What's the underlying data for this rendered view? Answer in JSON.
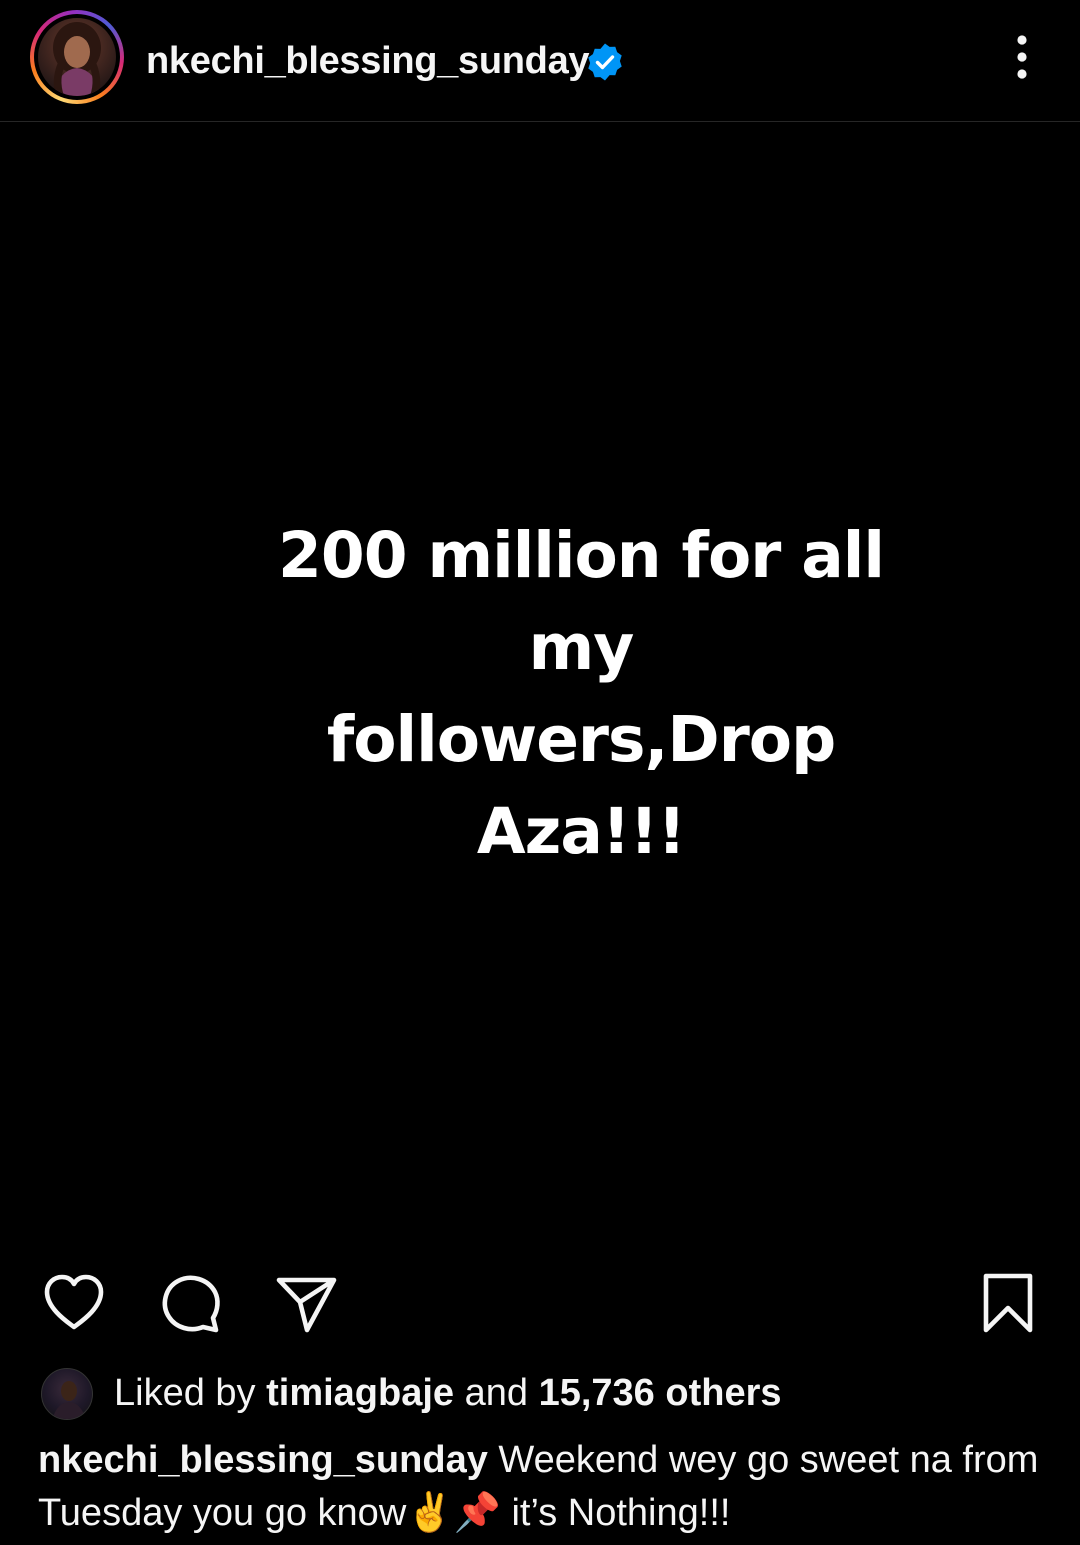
{
  "post": {
    "username": "nkechi_blessing_sunday",
    "verified": true,
    "image_text_line1": "200 million for all my",
    "image_text_line2": "followers,Drop Aza!!!"
  },
  "icons": {
    "more": "more-vertical-icon",
    "like": "heart-icon",
    "comment": "comment-icon",
    "share": "send-icon",
    "save": "bookmark-icon",
    "verified": "verified-badge-icon"
  },
  "likes": {
    "prefix": "Liked by",
    "liker": "timiagbaje",
    "joiner": "and",
    "others": "15,736 others"
  },
  "caption": {
    "username": "nkechi_blessing_sunday",
    "text": "Weekend wey go sweet na from Tuesday you go know",
    "emoji": "✌️📌",
    "suffix": "it’s Nothing!!!"
  },
  "colors": {
    "background": "#000000",
    "text": "#f5f5f5",
    "verified_blue": "#0095f6"
  }
}
